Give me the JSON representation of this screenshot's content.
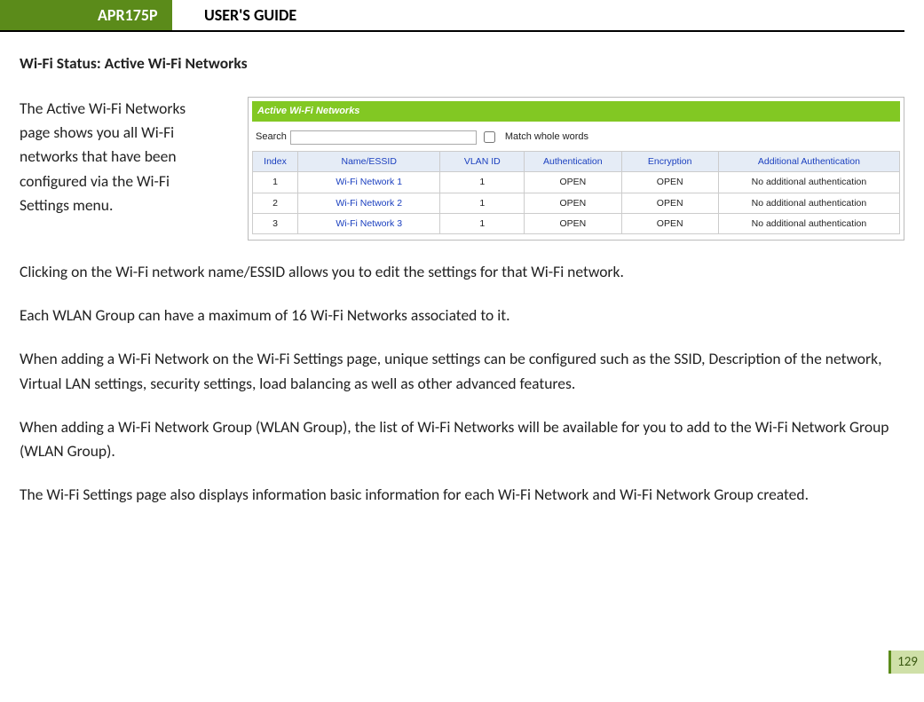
{
  "header": {
    "model": "APR175P",
    "title": "USER'S GUIDE"
  },
  "section": {
    "heading": "Wi-Fi Status: Active Wi-Fi Networks",
    "intro": "The Active Wi-Fi Networks page shows you all Wi-Fi networks that have been configured via the Wi-Fi Settings menu."
  },
  "panel": {
    "title": "Active Wi-Fi Networks",
    "search_label": "Search",
    "search_value": "",
    "match_label": "Match whole words",
    "columns": {
      "index": "Index",
      "name": "Name/ESSID",
      "vlan": "VLAN ID",
      "auth": "Authentication",
      "enc": "Encryption",
      "addl": "Additional Authentication"
    },
    "rows": [
      {
        "index": "1",
        "name": "Wi-Fi Network 1",
        "vlan": "1",
        "auth": "OPEN",
        "enc": "OPEN",
        "addl": "No additional authentication"
      },
      {
        "index": "2",
        "name": "Wi-Fi Network 2",
        "vlan": "1",
        "auth": "OPEN",
        "enc": "OPEN",
        "addl": "No additional authentication"
      },
      {
        "index": "3",
        "name": "Wi-Fi Network 3",
        "vlan": "1",
        "auth": "OPEN",
        "enc": "OPEN",
        "addl": "No additional authentication"
      }
    ]
  },
  "body": {
    "p1": "Clicking on the Wi-Fi network name/ESSID allows you to edit the settings for that Wi-Fi network.",
    "p2": "Each WLAN Group can have a maximum of 16 Wi-Fi Networks associated to it.",
    "p3": "When adding a Wi-Fi Network on the Wi-Fi Settings page, unique settings can be configured such as the SSID, Description of the network, Virtual LAN settings, security settings, load balancing as well as other advanced features.",
    "p4": "When adding a Wi-Fi Network Group (WLAN Group), the list of Wi-Fi Networks will be available for you to add to the Wi-Fi Network Group (WLAN Group).",
    "p5": "The Wi-Fi Settings page also displays information basic information for each Wi-Fi Network and Wi-Fi Network Group created."
  },
  "page_number": "129"
}
